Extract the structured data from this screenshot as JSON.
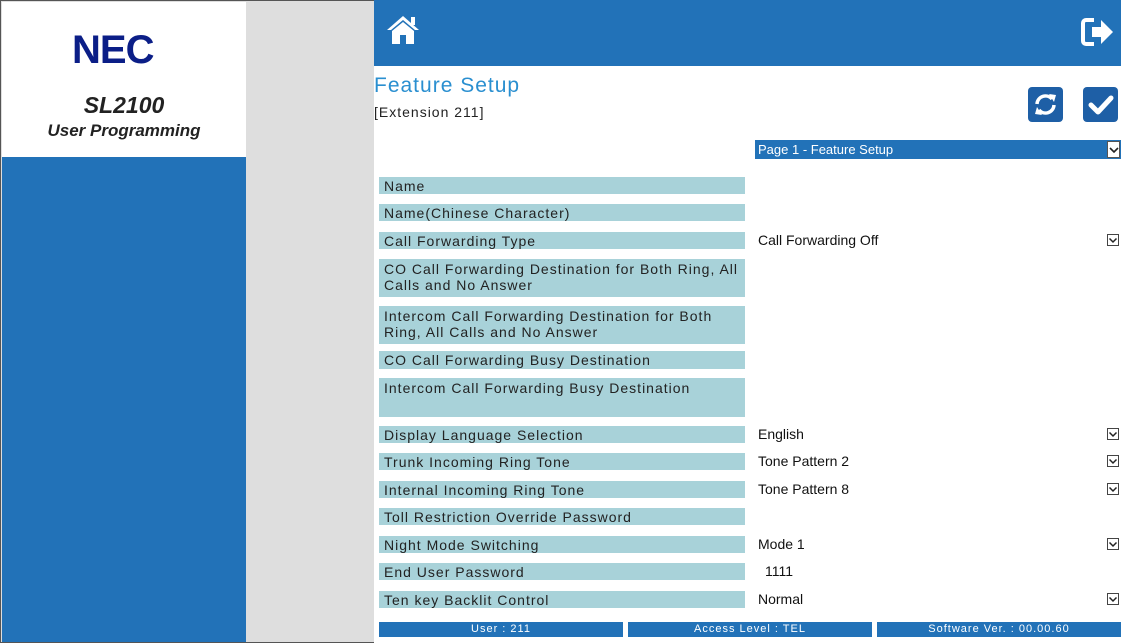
{
  "brand": {
    "logo": "NEC",
    "model": "SL2100",
    "subtitle": "User Programming"
  },
  "header": {
    "home_icon": "home-icon",
    "logout_icon": "logout-arrow-icon"
  },
  "page": {
    "title": "Feature Setup",
    "extension": "[Extension 211]"
  },
  "actions": {
    "refresh_icon": "refresh-icon",
    "apply_icon": "checkmark-icon"
  },
  "page_select": {
    "value": "Page 1 - Feature Setup"
  },
  "rows": [
    {
      "label": "Name",
      "value": ""
    },
    {
      "label": "Name(Chinese Character)",
      "value": ""
    },
    {
      "label": "Call Forwarding Type",
      "value": "Call Forwarding Off"
    },
    {
      "label": "CO Call Forwarding Destination for Both Ring, All Calls and No Answer",
      "value": ""
    },
    {
      "label": "Intercom Call Forwarding Destination for Both Ring, All Calls and No Answer",
      "value": ""
    },
    {
      "label": "CO Call Forwarding Busy Destination",
      "value": ""
    },
    {
      "label": "Intercom Call Forwarding Busy Destination",
      "value": ""
    },
    {
      "label": "Display Language Selection",
      "value": "English"
    },
    {
      "label": "Trunk Incoming Ring Tone",
      "value": "Tone Pattern 2"
    },
    {
      "label": "Internal Incoming Ring Tone",
      "value": "Tone Pattern 8"
    },
    {
      "label": "Toll Restriction Override Password",
      "value": ""
    },
    {
      "label": "Night Mode Switching",
      "value": "Mode 1"
    },
    {
      "label": "End User Password",
      "value": "1111"
    },
    {
      "label": "Ten key Backlit Control",
      "value": "Normal"
    }
  ],
  "footer": {
    "user": "User : 211",
    "access_level": "Access Level : TEL",
    "software_version": "Software Ver. : 00.00.60"
  }
}
